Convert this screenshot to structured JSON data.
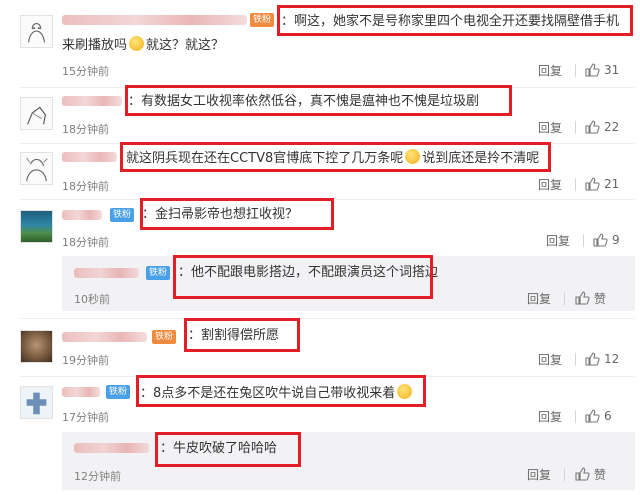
{
  "labels": {
    "reply": "回复",
    "like": "赞"
  },
  "badges": {
    "iron_fan": "铁粉"
  },
  "comments": [
    {
      "text_line1": "：啊这，她家不是号称家里四个电视全开还要找隔壁借手机",
      "text_line2_a": "来刷播放吗",
      "text_line2_b": "就这？就这？",
      "time": "15分钟前",
      "likes": "31"
    },
    {
      "text": "：有数据女工收视率依然低谷，真不愧是瘟神也不愧是垃圾剧",
      "time": "18分钟前",
      "likes": "22"
    },
    {
      "text_a": "就这阴兵现在还在CCTV8官博底下控了几万条呢",
      "text_b": "说到底还是拎不清呢",
      "time": "18分钟前",
      "likes": "21"
    },
    {
      "text": "：金扫帚影帝也想扛收视？",
      "time": "18分钟前",
      "likes": "9"
    },
    {
      "text": "：割割得偿所愿",
      "time": "19分钟前",
      "likes": "12"
    },
    {
      "text_a": "：8点多不是还在兔区吹牛说自己带收视来着",
      "time": "17分钟前",
      "likes": "6"
    }
  ],
  "sub_replies": [
    {
      "text": "：他不配跟电影搭边，不配跟演员这个词搭边",
      "time": "10秒前"
    },
    {
      "text": "：牛皮吹破了哈哈哈",
      "time": "12分钟前"
    }
  ],
  "colors": {
    "highlight": "#e41e26",
    "badge_blue": "#4aa0e6",
    "badge_orange": "#f08a3e"
  }
}
